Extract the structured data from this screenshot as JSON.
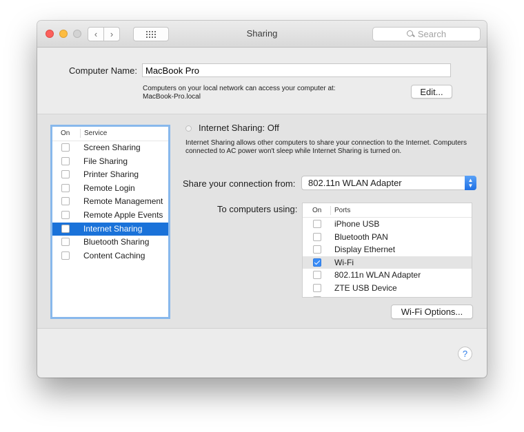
{
  "window": {
    "title": "Sharing"
  },
  "toolbar": {
    "back_glyph": "‹",
    "forward_glyph": "›",
    "search_placeholder": "Search",
    "icons": [
      "back-chevron-icon",
      "forward-chevron-icon",
      "grid-icon",
      "search-icon"
    ]
  },
  "computer_name": {
    "label": "Computer Name:",
    "value": "MacBook Pro",
    "note_line1": "Computers on your local network can access your computer at:",
    "note_line2": "MacBook-Pro.local",
    "edit_label": "Edit..."
  },
  "services": {
    "header_on": "On",
    "header_service": "Service",
    "items": [
      {
        "label": "Screen Sharing",
        "checked": false
      },
      {
        "label": "File Sharing",
        "checked": false
      },
      {
        "label": "Printer Sharing",
        "checked": false
      },
      {
        "label": "Remote Login",
        "checked": false
      },
      {
        "label": "Remote Management",
        "checked": false
      },
      {
        "label": "Remote Apple Events",
        "checked": false
      },
      {
        "label": "Internet Sharing",
        "checked": false,
        "selected": true
      },
      {
        "label": "Bluetooth Sharing",
        "checked": false
      },
      {
        "label": "Content Caching",
        "checked": false
      }
    ]
  },
  "internet_sharing": {
    "status_title": "Internet Sharing: Off",
    "description": "Internet Sharing allows other computers to share your connection to the Internet. Computers connected to AC power won't sleep while Internet Sharing is turned on.",
    "share_from_label": "Share your connection from:",
    "share_from_value": "802.11n WLAN Adapter",
    "to_computers_label": "To computers using:",
    "ports_header_on": "On",
    "ports_header_ports": "Ports",
    "ports": [
      {
        "label": "iPhone USB",
        "checked": false
      },
      {
        "label": "Bluetooth PAN",
        "checked": false
      },
      {
        "label": "Display Ethernet",
        "checked": false
      },
      {
        "label": "Wi-Fi",
        "checked": true,
        "highlighted": true
      },
      {
        "label": "802.11n WLAN Adapter",
        "checked": false
      },
      {
        "label": "ZTE USB Device",
        "checked": false
      }
    ],
    "wifi_options_label": "Wi-Fi Options..."
  },
  "help": {
    "label": "?"
  },
  "colors": {
    "selection": "#1a72d9",
    "checkbox_checked": "#3a8cf7",
    "focus_ring": "#88b8ec"
  }
}
